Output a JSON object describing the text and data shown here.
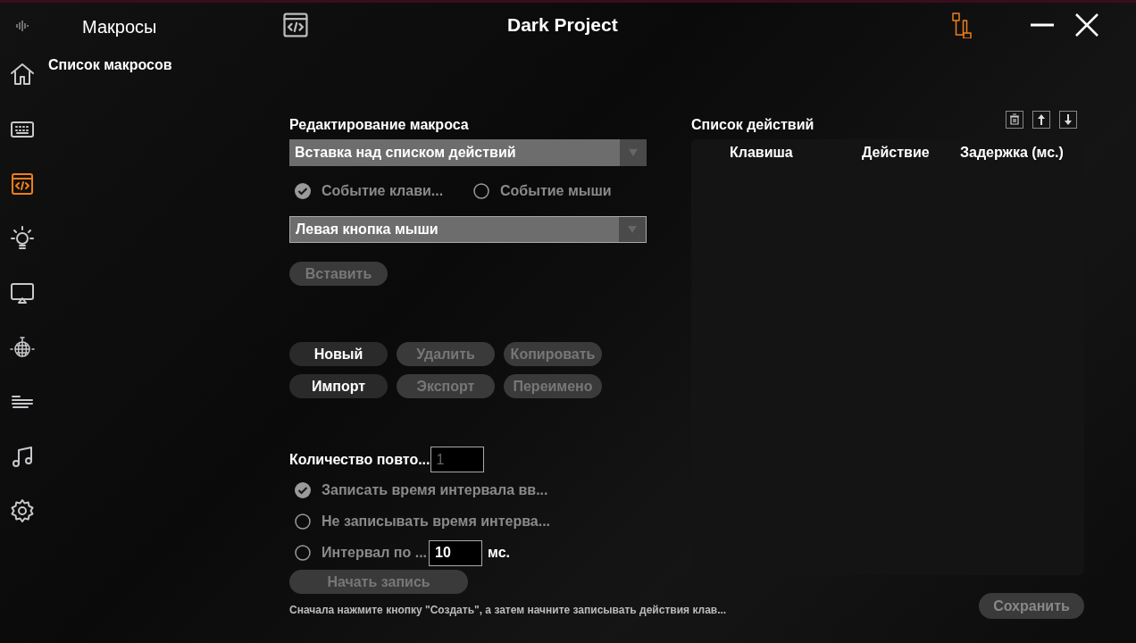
{
  "window": {
    "title": "Dark Project"
  },
  "nav": [
    {
      "selected": false
    },
    {
      "selected": false
    },
    {
      "selected": true
    },
    {
      "selected": false
    },
    {
      "selected": false
    },
    {
      "selected": false
    },
    {
      "selected": false
    },
    {
      "selected": false
    },
    {
      "selected": false
    }
  ],
  "panel": {
    "title": "Макросы",
    "subtitle": "Список макросов"
  },
  "editor": {
    "heading": "Редактирование макроса",
    "insert_mode": {
      "value": "Вставка над списком действий"
    },
    "event_types": [
      {
        "label": "Событие клави...",
        "selected": true
      },
      {
        "label": "Событие мыши",
        "selected": false
      }
    ],
    "key": {
      "value": "Левая кнопка мыши"
    },
    "insert_button": {
      "label": "Вставить",
      "disabled": true
    }
  },
  "macro_buttons": [
    {
      "label": "Новый",
      "disabled": false
    },
    {
      "label": "Удалить",
      "disabled": true
    },
    {
      "label": "Копировать",
      "disabled": true
    },
    {
      "label": "Импорт",
      "disabled": false
    },
    {
      "label": "Экспорт",
      "disabled": true
    },
    {
      "label": "Переимено",
      "disabled": true
    }
  ],
  "repeat": {
    "label": "Количество повто...",
    "value": "1",
    "disabled": true
  },
  "record_modes": [
    {
      "label": "Записать время интервала вв...",
      "selected": true,
      "kind": "plain"
    },
    {
      "label": "Не записывать время интерва...",
      "selected": false,
      "kind": "plain"
    },
    {
      "label": "Интервал по ...",
      "selected": false,
      "kind": "interval",
      "value": "10",
      "unit": "мс."
    }
  ],
  "record_button": {
    "label": "Начать запись",
    "disabled": true
  },
  "hint": "Сначала нажмите кнопку \"Создать\", а затем начните записывать действия клав...",
  "actions": {
    "title": "Список действий",
    "columns": [
      "Клавиша",
      "Действие",
      "Задержка (мс.)"
    ]
  },
  "save_button": {
    "label": "Сохранить",
    "disabled": true
  }
}
